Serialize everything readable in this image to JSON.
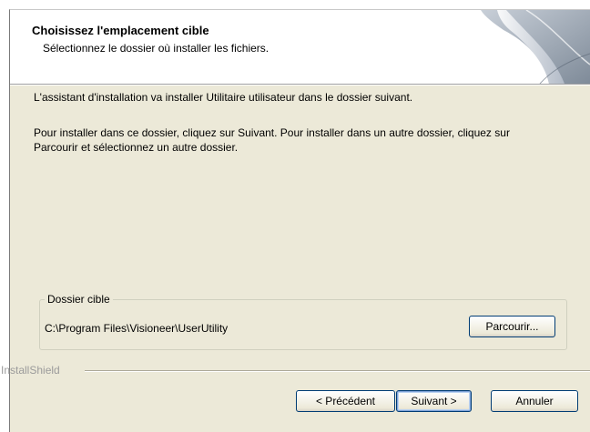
{
  "header": {
    "title": "Choisissez l'emplacement cible",
    "subtitle": "Sélectionnez le dossier où installer les fichiers."
  },
  "body": {
    "line1": "L'assistant d'installation va installer Utilitaire utilisateur dans le dossier suivant.",
    "line2": "Pour installer dans ce dossier, cliquez sur Suivant. Pour installer dans un autre dossier, cliquez sur Parcourir et sélectionnez un autre dossier."
  },
  "destination": {
    "label": "Dossier cible",
    "path": "C:\\Program Files\\Visioneer\\UserUtility",
    "browse_label": "Parcourir..."
  },
  "footer": {
    "brand": "InstallShield",
    "back_label": "< Précédent",
    "next_label": "Suivant >",
    "cancel_label": "Annuler"
  },
  "icons": {
    "header_art": "page-curl-graphic"
  }
}
